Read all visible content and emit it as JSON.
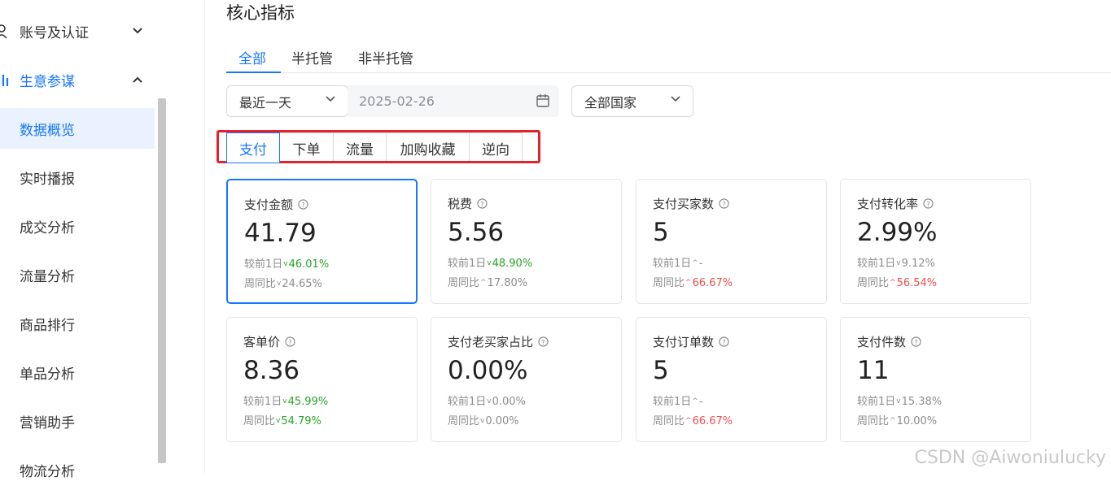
{
  "sidebar": {
    "groups": [
      {
        "label": "账号及认证",
        "chevron": "chevron-down-icon"
      },
      {
        "label": "生意参谋",
        "chevron": "chevron-up-icon"
      }
    ],
    "items": [
      {
        "label": "数据概览",
        "active": true
      },
      {
        "label": "实时播报"
      },
      {
        "label": "成交分析"
      },
      {
        "label": "流量分析"
      },
      {
        "label": "商品排行"
      },
      {
        "label": "单品分析"
      },
      {
        "label": "营销助手"
      },
      {
        "label": "物流分析"
      }
    ]
  },
  "main": {
    "title": "核心指标",
    "tabs": [
      {
        "label": "全部",
        "active": true
      },
      {
        "label": "半托管"
      },
      {
        "label": "非半托管"
      }
    ],
    "filters": {
      "period": "最近一天",
      "date": "2025-02-26",
      "country": "全部国家"
    },
    "segments": [
      {
        "label": "支付",
        "active": true
      },
      {
        "label": "下单"
      },
      {
        "label": "流量"
      },
      {
        "label": "加购收藏"
      },
      {
        "label": "逆向"
      }
    ],
    "cards": [
      {
        "title": "支付金额",
        "value": "41.79",
        "l1_label": "较前1日",
        "l1_dir": "down",
        "l1_val": "46.01%",
        "l1_color": "green",
        "l2_label": "周同比",
        "l2_dir": "down",
        "l2_val": "24.65%",
        "l2_color": "gray",
        "active": true
      },
      {
        "title": "税费",
        "value": "5.56",
        "l1_label": "较前1日",
        "l1_dir": "down",
        "l1_val": "48.90%",
        "l1_color": "green",
        "l2_label": "周同比",
        "l2_dir": "up",
        "l2_val": "17.80%",
        "l2_color": "gray"
      },
      {
        "title": "支付买家数",
        "value": "5",
        "l1_label": "较前1日",
        "l1_dir": "up",
        "l1_val": "-",
        "l1_color": "gray",
        "l2_label": "周同比",
        "l2_dir": "up",
        "l2_val": "66.67%",
        "l2_color": "red"
      },
      {
        "title": "支付转化率",
        "value": "2.99%",
        "l1_label": "较前1日",
        "l1_dir": "down",
        "l1_val": "9.12%",
        "l1_color": "gray",
        "l2_label": "周同比",
        "l2_dir": "up",
        "l2_val": "56.54%",
        "l2_color": "red"
      },
      {
        "title": "客单价",
        "value": "8.36",
        "l1_label": "较前1日",
        "l1_dir": "down",
        "l1_val": "45.99%",
        "l1_color": "green",
        "l2_label": "周同比",
        "l2_dir": "down",
        "l2_val": "54.79%",
        "l2_color": "green"
      },
      {
        "title": "支付老买家占比",
        "value": "0.00%",
        "l1_label": "较前1日",
        "l1_dir": "down",
        "l1_val": "0.00%",
        "l1_color": "gray",
        "l2_label": "周同比",
        "l2_dir": "down",
        "l2_val": "0.00%",
        "l2_color": "gray"
      },
      {
        "title": "支付订单数",
        "value": "5",
        "l1_label": "较前1日",
        "l1_dir": "up",
        "l1_val": "-",
        "l1_color": "gray",
        "l2_label": "周同比",
        "l2_dir": "up",
        "l2_val": "66.67%",
        "l2_color": "red"
      },
      {
        "title": "支付件数",
        "value": "11",
        "l1_label": "较前1日",
        "l1_dir": "down",
        "l1_val": "15.38%",
        "l1_color": "gray",
        "l2_label": "周同比",
        "l2_dir": "up",
        "l2_val": "10.00%",
        "l2_color": "gray"
      }
    ]
  },
  "watermark": "CSDN @Aiwoniulucky",
  "colors": {
    "accent": "#1677ff",
    "up": "#ef4f4f",
    "down": "#29a329",
    "highlight": "#e3222b"
  }
}
